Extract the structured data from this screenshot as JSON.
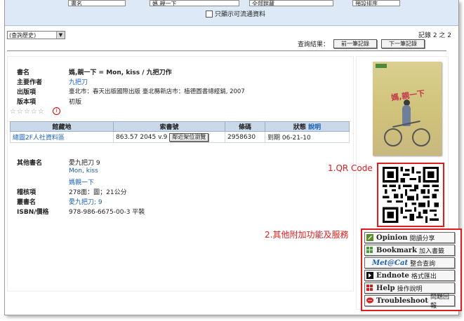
{
  "search": {
    "field1": "書名",
    "field2": "媽,親一下",
    "field3": "全部館藏",
    "field4": "預設排序",
    "available_only": "只顯示可流通資料"
  },
  "history_select": "(查詢歷史)",
  "record_count": "記錄 2 之 2",
  "nav": {
    "result_label": "查詢結果：",
    "prev": "前一筆記錄",
    "next": "下一筆記錄"
  },
  "record": {
    "title_label": "書名",
    "title": "媽,親一下 = Mon, kiss / 九把刀作",
    "author_label": "主要作者",
    "author": "九把刀",
    "publish_label": "出版項",
    "publish": "臺北市：春天出版國際出版 臺北縣新店市：植德圖書總經銷, 2007",
    "edition_label": "版本項",
    "edition": "初版",
    "other_titles_label": "其他書名",
    "other_titles": [
      "愛九把刀 9",
      "Mon, kiss",
      "媽親一下"
    ],
    "collation_label": "稽核項",
    "collation": "278面：圖；21公分",
    "series_label": "叢書名",
    "series": "愛九把刀; 9",
    "isbn_label": "ISBN/價格",
    "isbn": "978-986-6675-00-3 平裝"
  },
  "holdings": {
    "headers": [
      "館藏地",
      "索書號",
      "條碼",
      "狀態"
    ],
    "status_link": "說明",
    "rows": [
      {
        "location": "總圖2F人社資料區",
        "callno": "863.57 2045 v.9",
        "shelf_button": "鄰近架位瀏覽",
        "barcode": "2958630",
        "status": "到期 06-21-10"
      }
    ]
  },
  "cover": {
    "title": "媽,親一下"
  },
  "annotations": {
    "qr_label": "1.QR Code",
    "services_label": "2.其他附加功能及服務"
  },
  "services": [
    {
      "name": "Opinion",
      "zh": "閱讀分享",
      "icon": "pencil-icon",
      "color": "#5a8a2a"
    },
    {
      "name": "Bookmark",
      "zh": "加入書籤",
      "icon": "bookmark-grid-icon",
      "color": "#4a9a3a"
    },
    {
      "name": "Met@Cat",
      "zh": "整合查詢",
      "icon": "metacat-logo-icon",
      "color": "#1a5fb4"
    },
    {
      "name": "Endnote",
      "zh": "格式匯出",
      "icon": "endnote-icon",
      "color": "#111111"
    },
    {
      "name": "Help",
      "zh": "操作說明",
      "icon": "help-icon",
      "color": "#d02020"
    },
    {
      "name": "Troubleshoot",
      "zh": "問題回報",
      "icon": "troubleshoot-icon",
      "color": "#d02020"
    }
  ]
}
